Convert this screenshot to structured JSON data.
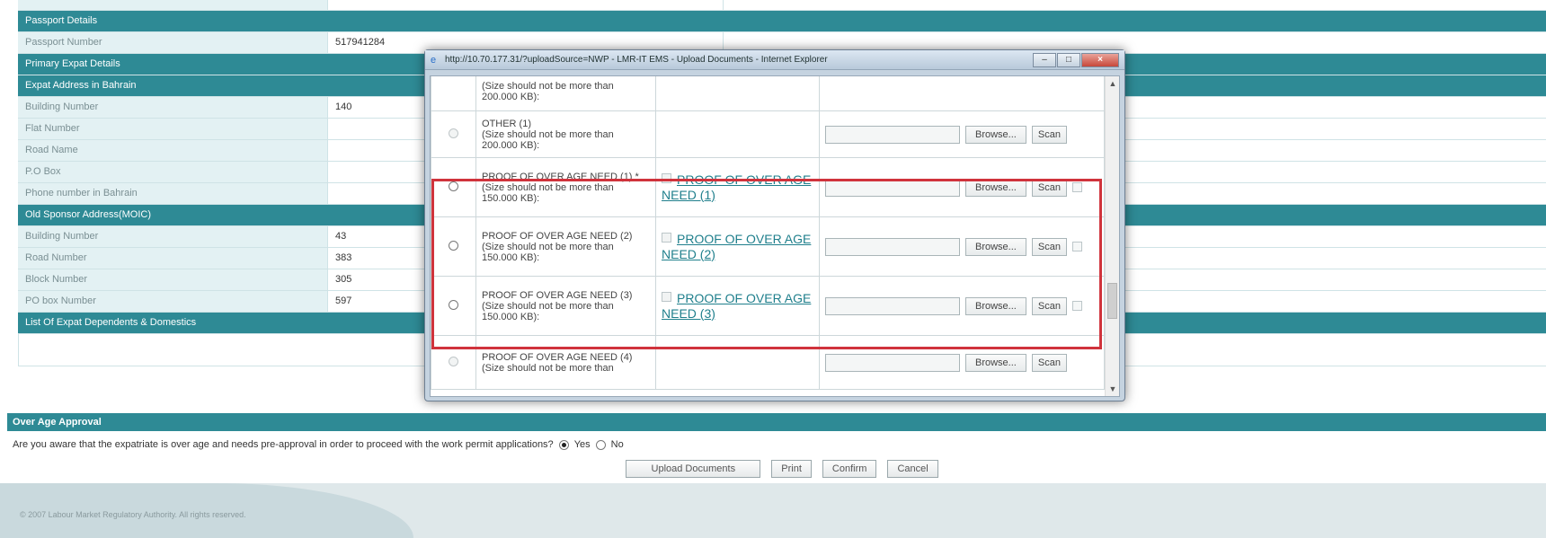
{
  "form": {
    "top_row_clip": "",
    "passport_section": "Passport Details",
    "passport_number_label": "Passport Number",
    "passport_number_value": "517941284",
    "primary_expat_section": "Primary Expat Details",
    "expat_address_section": "Expat Address in Bahrain",
    "building_number_label": "Building Number",
    "building_number_value": "140",
    "flat_number_label": "Flat Number",
    "road_name_label": "Road Name",
    "po_box_label": "P.O Box",
    "phone_label": "Phone number in Bahrain",
    "old_sponsor_section": "Old Sponsor Address(MOIC)",
    "os_building_label": "Building Number",
    "os_building_value": "43",
    "os_road_label": "Road Number",
    "os_road_value": "383",
    "os_block_label": "Block Number",
    "os_block_value": "305",
    "os_pobox_label": "PO box Number",
    "os_pobox_value": "597",
    "dependents_section": "List Of Expat Dependents & Domestics"
  },
  "over_age": {
    "heading": "Over Age Approval",
    "question": "Are you aware that the expatriate is over age and needs pre-approval in order to proceed with the work permit applications?",
    "yes_label": "Yes",
    "no_label": "No",
    "selected": "Yes"
  },
  "actions": {
    "upload": "Upload Documents",
    "print": "Print",
    "confirm": "Confirm",
    "cancel": "Cancel"
  },
  "footer": {
    "copyright": "© 2007 Labour Market Regulatory Authority. All rights reserved."
  },
  "popup": {
    "title": "http://10.70.177.31/?uploadSource=NWP - LMR-IT EMS - Upload Documents - Internet Explorer",
    "browse_label": "Browse...",
    "scan_label": "Scan",
    "rows": [
      {
        "desc_name": "",
        "desc_size": "(Size should not be more than 200.000 KB):",
        "link": ""
      },
      {
        "desc_name": "OTHER (1)",
        "desc_size": "(Size should not be more than 200.000 KB):",
        "link": ""
      },
      {
        "desc_name": "PROOF OF OVER AGE NEED (1) *",
        "desc_size": "(Size should not be more than 150.000 KB):",
        "link": "PROOF OF OVER AGE NEED (1)"
      },
      {
        "desc_name": "PROOF OF OVER AGE NEED (2)",
        "desc_size": "(Size should not be more than 150.000 KB):",
        "link": "PROOF OF OVER AGE NEED (2)"
      },
      {
        "desc_name": "PROOF OF OVER AGE NEED (3)",
        "desc_size": "(Size should not be more than 150.000 KB):",
        "link": "PROOF OF OVER AGE NEED (3)"
      },
      {
        "desc_name": "PROOF OF OVER AGE NEED (4)",
        "desc_size": "(Size should not be more than",
        "link": ""
      }
    ]
  },
  "colors": {
    "section_header": "#2e8a95",
    "label_bg": "#e3f1f3",
    "highlight": "#d0333c",
    "link": "#1f7f8c"
  }
}
